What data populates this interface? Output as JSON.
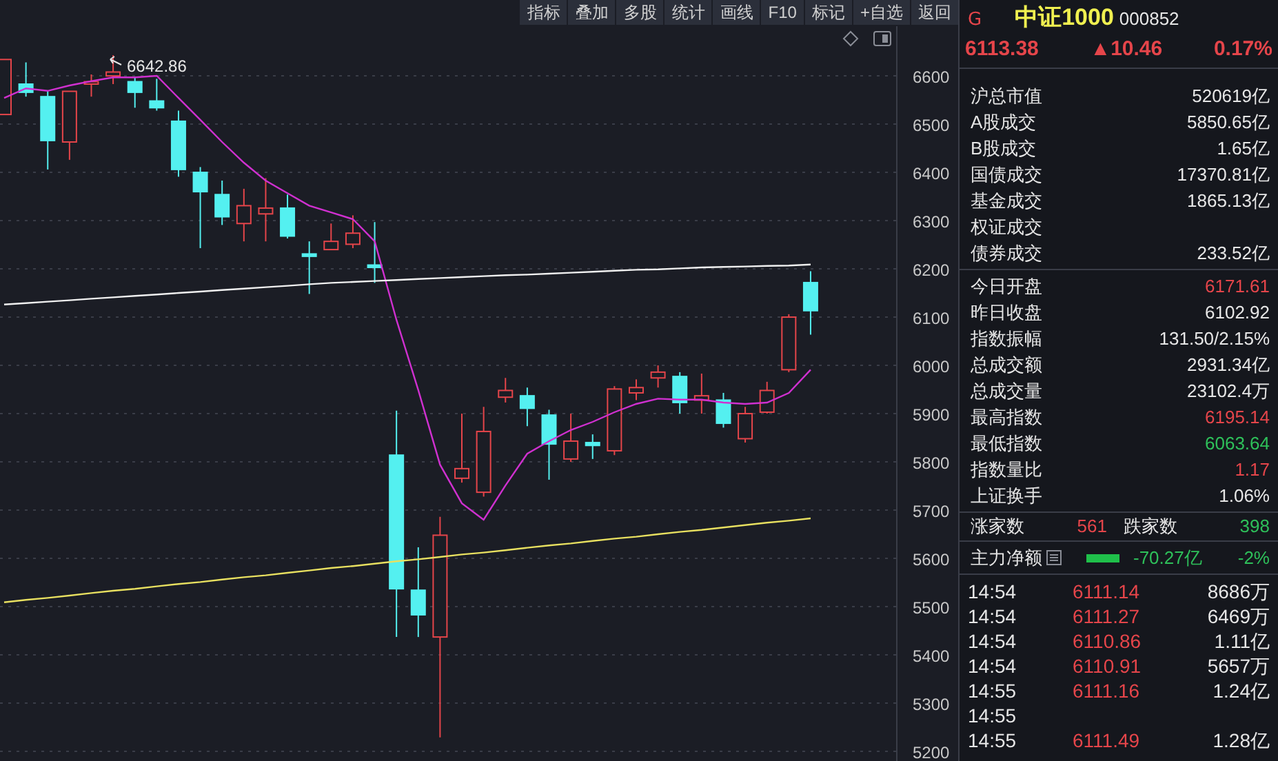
{
  "toolbar": {
    "buttons": [
      "指标",
      "叠加",
      "多股",
      "统计",
      "画线",
      "F10",
      "标记",
      "+自选",
      "返回"
    ]
  },
  "chart": {
    "high_marker": "6642.86",
    "chart_data": {
      "type": "candlestick",
      "grid": true,
      "ylim": [
        5180,
        6703
      ],
      "yticks": [
        6600,
        6500,
        6400,
        6300,
        6200,
        6100,
        6000,
        5900,
        5800,
        5700,
        5600,
        5500,
        5400,
        5300,
        5200
      ],
      "ohlc": [
        [
          6520,
          6634,
          6520,
          6634
        ],
        [
          6583,
          6628,
          6557,
          6566
        ],
        [
          6557,
          6568,
          6406,
          6466
        ],
        [
          6463,
          6568,
          6426,
          6568
        ],
        [
          6583,
          6603,
          6557,
          6588
        ],
        [
          6600,
          6642.86,
          6583,
          6608
        ],
        [
          6588,
          6597,
          6534,
          6566
        ],
        [
          6548,
          6594,
          6528,
          6534
        ],
        [
          6506,
          6528,
          6391,
          6406
        ],
        [
          6400,
          6411,
          6243,
          6360
        ],
        [
          6354,
          6383,
          6291,
          6308
        ],
        [
          6294,
          6366,
          6257,
          6331
        ],
        [
          6314,
          6388,
          6257,
          6326
        ],
        [
          6326,
          6354,
          6263,
          6268
        ],
        [
          6231,
          6257,
          6148,
          6226
        ],
        [
          6240,
          6294,
          6240,
          6257
        ],
        [
          6251,
          6311,
          6243,
          6274
        ],
        [
          6208,
          6297,
          6171,
          6203
        ],
        [
          5814,
          5906,
          5437,
          5537
        ],
        [
          5534,
          5623,
          5437,
          5483
        ],
        [
          5437,
          5686,
          5229,
          5648
        ],
        [
          5766,
          5900,
          5757,
          5786
        ],
        [
          5737,
          5914,
          5728,
          5863
        ],
        [
          5934,
          5974,
          5923,
          5948
        ],
        [
          5937,
          5954,
          5874,
          5911
        ],
        [
          5897,
          5908,
          5763,
          5837
        ],
        [
          5806,
          5900,
          5800,
          5843
        ],
        [
          5840,
          5857,
          5806,
          5834
        ],
        [
          5823,
          5957,
          5814,
          5951
        ],
        [
          5943,
          5971,
          5928,
          5954
        ],
        [
          5974,
          6000,
          5954,
          5986
        ],
        [
          5977,
          5986,
          5900,
          5923
        ],
        [
          5928,
          5983,
          5900,
          5937
        ],
        [
          5928,
          5943,
          5871,
          5880
        ],
        [
          5848,
          5914,
          5840,
          5900
        ],
        [
          5903,
          5966,
          5900,
          5948
        ],
        [
          5991,
          6106,
          5986,
          6100
        ],
        [
          6171.61,
          6195.14,
          6063.64,
          6113.38
        ]
      ],
      "series": [
        {
          "type": "line",
          "color": "#d030d0",
          "values": [
            6554,
            6574,
            6569,
            6580,
            6589,
            6597,
            6597,
            6600,
            6554,
            6509,
            6463,
            6420,
            6383,
            6357,
            6331,
            6317,
            6303,
            6257,
            6094,
            5949,
            5794,
            5714,
            5680,
            5751,
            5817,
            5843,
            5866,
            5883,
            5903,
            5920,
            5931,
            5929,
            5929,
            5923,
            5920,
            5923,
            5943,
            5991
          ]
        },
        {
          "type": "line",
          "color": "#f0f0f0",
          "values": [
            6126,
            6129,
            6132,
            6135,
            6138,
            6141,
            6144,
            6147,
            6150,
            6153,
            6156,
            6159,
            6162,
            6165,
            6168,
            6171,
            6173,
            6175,
            6177,
            6179,
            6181,
            6183,
            6185,
            6187,
            6188,
            6190,
            6192,
            6194,
            6196,
            6198,
            6199,
            6201,
            6203,
            6204,
            6205,
            6206,
            6207,
            6209
          ]
        },
        {
          "type": "line",
          "color": "#e8e060",
          "values": [
            5509,
            5514,
            5518,
            5523,
            5528,
            5533,
            5537,
            5542,
            5547,
            5551,
            5556,
            5561,
            5565,
            5570,
            5575,
            5580,
            5584,
            5589,
            5594,
            5598,
            5603,
            5608,
            5612,
            5617,
            5622,
            5627,
            5631,
            5636,
            5641,
            5645,
            5650,
            5655,
            5659,
            5664,
            5669,
            5674,
            5678,
            5683
          ]
        }
      ]
    }
  },
  "quote": {
    "market_tag": "G",
    "name": "中证1000",
    "code": "000852",
    "price": "6113.38",
    "change": "▲10.46",
    "change_pct": "0.17%"
  },
  "market_stats": [
    {
      "label": "沪总市值",
      "value": "520619亿",
      "color": "#e6e6e6"
    },
    {
      "label": "A股成交",
      "value": "5850.65亿",
      "color": "#e6e6e6"
    },
    {
      "label": "B股成交",
      "value": "1.65亿",
      "color": "#e6e6e6"
    },
    {
      "label": "国债成交",
      "value": "17370.81亿",
      "color": "#e6e6e6"
    },
    {
      "label": "基金成交",
      "value": "1865.13亿",
      "color": "#e6e6e6"
    },
    {
      "label": "权证成交"
    },
    {
      "label": "债券成交",
      "value": "233.52亿",
      "color": "#e6e6e6"
    }
  ],
  "index_stats": [
    {
      "label": "今日开盘",
      "value": "6171.61",
      "color": "#e5454a"
    },
    {
      "label": "昨日收盘",
      "value": "6102.92",
      "color": "#e6e6e6"
    },
    {
      "label": "指数振幅",
      "value": "131.50/2.15%",
      "color": "#e6e6e6"
    },
    {
      "label": "总成交额",
      "value": "2931.34亿",
      "color": "#e6e6e6"
    },
    {
      "label": "总成交量",
      "value": "23102.4万",
      "color": "#e6e6e6"
    },
    {
      "label": "最高指数",
      "value": "6195.14",
      "color": "#e5454a"
    },
    {
      "label": "最低指数",
      "value": "6063.64",
      "color": "#2ec05a"
    },
    {
      "label": "指数量比",
      "value": "1.17",
      "color": "#e5454a"
    },
    {
      "label": "上证换手",
      "value": "1.06%",
      "color": "#e6e6e6"
    }
  ],
  "breadth": {
    "up_label": "涨家数",
    "up_count": "561",
    "down_label": "跌家数",
    "down_count": "398"
  },
  "main_flow": {
    "label": "主力净额",
    "amount": "-70.27亿",
    "pct": "-2%"
  },
  "ticks": [
    {
      "time": "14:54",
      "price": "6111.14",
      "volume": "8686万"
    },
    {
      "time": "14:54",
      "price": "6111.27",
      "volume": "6469万"
    },
    {
      "time": "14:54",
      "price": "6110.86",
      "volume": "1.11亿"
    },
    {
      "time": "14:54",
      "price": "6110.91",
      "volume": "5657万"
    },
    {
      "time": "14:55",
      "price": "6111.16",
      "volume": "1.24亿"
    },
    {
      "time": "14:55"
    },
    {
      "time": "14:55",
      "price": "6111.49",
      "volume": "1.28亿"
    }
  ]
}
